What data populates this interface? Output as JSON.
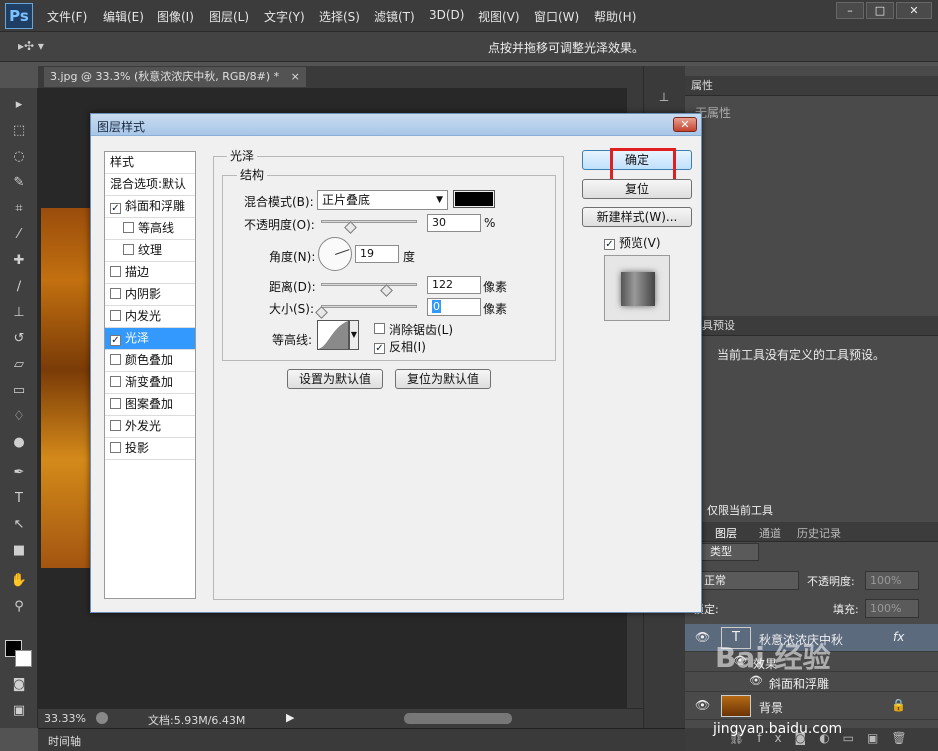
{
  "app": {
    "logo": "Ps"
  },
  "menu": [
    "文件(F)",
    "编辑(E)",
    "图像(I)",
    "图层(L)",
    "文字(Y)",
    "选择(S)",
    "滤镜(T)",
    "3D(D)",
    "视图(V)",
    "窗口(W)",
    "帮助(H)"
  ],
  "window_controls": {
    "min": "–",
    "max": "□",
    "close": "✕"
  },
  "options_bar": {
    "hint": "点按并拖移可调整光泽效果。"
  },
  "document": {
    "tab_title": "3.jpg @ 33.3% (秋意浓浓庆中秋, RGB/8#) *",
    "tab_close": "×",
    "zoom": "33.33%",
    "doc_size": "文档:5.93M/6.43M"
  },
  "timeline": {
    "label": "时间轴"
  },
  "panels": {
    "properties": {
      "tab": "属性",
      "subtitle": "无属性"
    },
    "tool_presets": {
      "tab": "工具预设",
      "empty_text": "当前工具没有定义的工具预设。",
      "current_only": "仅限当前工具"
    },
    "layers": {
      "tabs": [
        "图层",
        "通道",
        "历史记录"
      ],
      "filter_kind": "类型",
      "blend_mode": "正常",
      "opacity_label": "不透明度:",
      "opacity_value": "100%",
      "lock_label": "锁定:",
      "fill_label": "填充:",
      "fill_value": "100%",
      "rows": [
        {
          "thumb": "T",
          "name": "秋意浓浓庆中秋",
          "fx": "fx"
        },
        {
          "name": "效果"
        },
        {
          "name": "斜面和浮雕"
        },
        {
          "name": "背景"
        }
      ]
    }
  },
  "dialog": {
    "title": "图层样式",
    "close": "✕",
    "style_list": {
      "header": "样式",
      "blend_options": "混合选项:默认",
      "items": [
        {
          "label": "斜面和浮雕",
          "checked": true
        },
        {
          "label": "等高线",
          "checked": false
        },
        {
          "label": "纹理",
          "checked": false
        },
        {
          "label": "描边",
          "checked": false
        },
        {
          "label": "内阴影",
          "checked": false
        },
        {
          "label": "内发光",
          "checked": false
        },
        {
          "label": "光泽",
          "checked": true
        },
        {
          "label": "颜色叠加",
          "checked": false
        },
        {
          "label": "渐变叠加",
          "checked": false
        },
        {
          "label": "图案叠加",
          "checked": false
        },
        {
          "label": "外发光",
          "checked": false
        },
        {
          "label": "投影",
          "checked": false
        }
      ]
    },
    "satin": {
      "title": "光泽",
      "structure": "结构",
      "blend_mode_label": "混合模式(B):",
      "blend_mode_value": "正片叠底",
      "color": "#000000",
      "opacity_label": "不透明度(O):",
      "opacity_value": "30",
      "opacity_unit": "%",
      "angle_label": "角度(N):",
      "angle_value": "19",
      "angle_unit": "度",
      "distance_label": "距离(D):",
      "distance_value": "122",
      "distance_unit": "像素",
      "size_label": "大小(S):",
      "size_value": "0",
      "size_unit": "像素",
      "contour_label": "等高线:",
      "antialias_label": "消除锯齿(L)",
      "antialias_checked": false,
      "invert_label": "反相(I)",
      "invert_checked": true,
      "make_default": "设置为默认值",
      "reset_default": "复位为默认值"
    },
    "buttons": {
      "ok": "确定",
      "reset": "复位",
      "new_style": "新建样式(W)...",
      "preview_label": "预览(V)",
      "preview_checked": true
    }
  },
  "colors": {
    "highlight": "#3399ff",
    "annotation": "#e02020"
  },
  "watermark": {
    "text": "Bai 经验",
    "sub": "jingyan.baidu.com"
  }
}
